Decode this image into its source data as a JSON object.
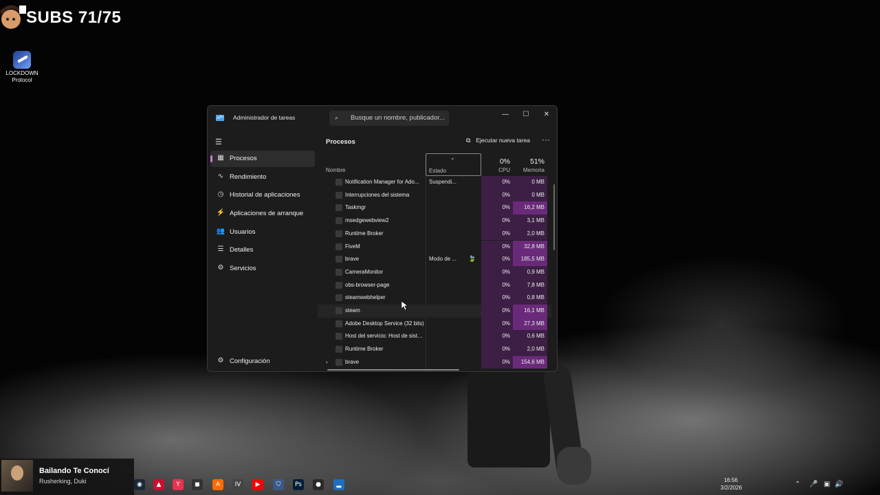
{
  "overlay": {
    "subs_text": "SUBS 71/75"
  },
  "desktop": {
    "icons": [
      {
        "label_line1": "LOCKDOWN",
        "label_line2": "Protocol",
        "icon": "lockdown-protocol-icon"
      }
    ]
  },
  "task_manager": {
    "title": "Administrador de tareas",
    "search_placeholder": "Busque un nombre, publicador...",
    "window_buttons": {
      "minimize": "—",
      "maximize": "☐",
      "close": "✕"
    },
    "nav": [
      {
        "label": "Procesos",
        "icon": "▦",
        "active": true
      },
      {
        "label": "Rendimiento",
        "icon": "∿"
      },
      {
        "label": "Historial de aplicaciones",
        "icon": "◷"
      },
      {
        "label": "Aplicaciones de arranque",
        "icon": "⚡"
      },
      {
        "label": "Usuarios",
        "icon": "👥"
      },
      {
        "label": "Detalles",
        "icon": "☰"
      },
      {
        "label": "Servicios",
        "icon": "⚙"
      }
    ],
    "settings_label": "Configuración",
    "main_title": "Procesos",
    "run_new_task_label": "Ejecutar nueva tarea",
    "more_label": "···",
    "columns": {
      "name": "Nombre",
      "status": "Estado",
      "cpu_pct": "0%",
      "cpu_label": "CPU",
      "mem_pct": "51%",
      "mem_label": "Memoria"
    },
    "processes": [
      {
        "name": "Notification Manager for Ado...",
        "status": "Suspendi...",
        "cpu": "0%",
        "mem": "0 MB",
        "high": false
      },
      {
        "name": "Interrupciones del sistema",
        "status": "",
        "cpu": "0%",
        "mem": "0 MB",
        "high": false
      },
      {
        "name": "Taskmgr",
        "status": "",
        "cpu": "0%",
        "mem": "16,2 MB",
        "high": true
      },
      {
        "name": "msedgewebview2",
        "status": "",
        "cpu": "0%",
        "mem": "3,1 MB",
        "high": false
      },
      {
        "name": "Runtime Broker",
        "status": "",
        "cpu": "0%",
        "mem": "2,0 MB",
        "high": false
      },
      {
        "name": "FiveM",
        "status": "",
        "cpu": "0%",
        "mem": "32,8 MB",
        "high": true
      },
      {
        "name": "brave",
        "status": "Modo de ...",
        "cpu": "0%",
        "mem": "185,5 MB",
        "high": true,
        "leaf": true
      },
      {
        "name": "CameraMonitor",
        "status": "",
        "cpu": "0%",
        "mem": "0,9 MB",
        "high": false
      },
      {
        "name": "obs-browser-page",
        "status": "",
        "cpu": "0%",
        "mem": "7,8 MB",
        "high": false
      },
      {
        "name": "steamwebhelper",
        "status": "",
        "cpu": "0%",
        "mem": "0,8 MB",
        "high": false
      },
      {
        "name": "steam",
        "status": "",
        "cpu": "0%",
        "mem": "16,1 MB",
        "high": true
      },
      {
        "name": "Adobe Desktop Service (32 bits)",
        "status": "",
        "cpu": "0%",
        "mem": "27,3 MB",
        "high": true
      },
      {
        "name": "Host del servicio: Host de siste...",
        "status": "",
        "cpu": "0%",
        "mem": "0,6 MB",
        "high": false
      },
      {
        "name": "Runtime Broker",
        "status": "",
        "cpu": "0%",
        "mem": "2,0 MB",
        "high": false
      },
      {
        "name": "brave",
        "status": "",
        "cpu": "0%",
        "mem": "154,6 MB",
        "high": true,
        "expandable": true
      }
    ]
  },
  "media": {
    "song": "Bailando Te Conocí",
    "artist": "Rusherking, Duki"
  },
  "taskbar": {
    "apps": [
      {
        "name": "steam-icon",
        "color": "#1b2838",
        "glyph": "◉"
      },
      {
        "name": "app-red-icon",
        "color": "#c8102e",
        "glyph": "▲"
      },
      {
        "name": "valorant-icon",
        "color": "#e4344f",
        "glyph": "Y"
      },
      {
        "name": "app-mask-icon",
        "color": "#333333",
        "glyph": "◼"
      },
      {
        "name": "app-orange-icon",
        "color": "#ff6a00",
        "glyph": "A"
      },
      {
        "name": "app-iv-icon",
        "color": "#444444",
        "glyph": "IV"
      },
      {
        "name": "youtube-music-icon",
        "color": "#ff0000",
        "glyph": "▶"
      },
      {
        "name": "app-shield-icon",
        "color": "#3a5a8a",
        "glyph": "⛉"
      },
      {
        "name": "photoshop-icon",
        "color": "#001e36",
        "glyph": "Ps"
      },
      {
        "name": "obs-icon",
        "color": "#2a2a2a",
        "glyph": "●"
      },
      {
        "name": "task-manager-icon",
        "color": "#1e6fbf",
        "glyph": "▂"
      }
    ],
    "tray": [
      "⌃",
      "🎤",
      "▣",
      "🔊"
    ],
    "time": "16:56",
    "date": "3/2/2026"
  }
}
